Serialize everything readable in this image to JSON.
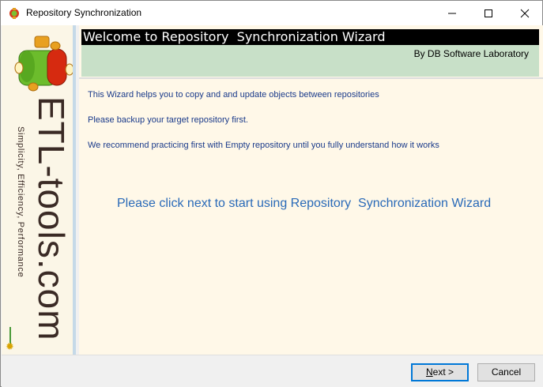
{
  "window": {
    "title": "Repository Synchronization",
    "caption_buttons": {
      "minimize_icon": "minimize-icon",
      "maximize_icon": "maximize-icon",
      "close_icon": "close-icon"
    }
  },
  "banner": {
    "brand": "ETL-tools.com",
    "tagline": "Simplicity, Efficiency, Performance",
    "logo_icon": "etl-cube-logo",
    "flower_glyph": "✹"
  },
  "wizard": {
    "heading": "Welcome to Repository  Synchronization Wizard",
    "company": "By DB Software Laboratory",
    "info_lines": [
      "This Wizard helps you to copy and and update objects between repositories",
      "Please backup your target repository first.",
      "We recommend practicing first with Empty repository until you fully understand how it works"
    ],
    "call_to_action": "Please click next to start using Repository  Synchronization Wizard"
  },
  "footer": {
    "next_prefix": "N",
    "next_rest": "ext >",
    "cancel_label": "Cancel"
  },
  "colors": {
    "heading_bg": "#000000",
    "subheader_bg": "#c8e0c8",
    "panel_bg": "#fff8e8",
    "info_text": "#1a3a8a",
    "cta_text": "#2a6ab8",
    "accent": "#0078d7"
  }
}
